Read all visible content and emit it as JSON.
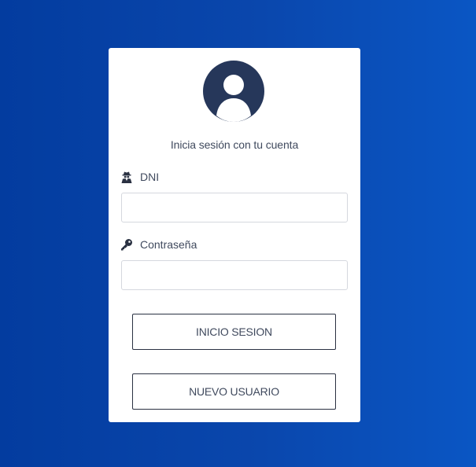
{
  "login": {
    "subtitle": "Inicia sesión con tu cuenta",
    "dni_label": "DNI",
    "dni_value": "",
    "password_label": "Contraseña",
    "password_value": "",
    "login_button": "INICIO SESION",
    "register_button": "NUEVO USUARIO"
  },
  "icons": {
    "avatar": "user-avatar-icon",
    "dni": "user-secret-icon",
    "password": "key-icon"
  },
  "colors": {
    "background_start": "#033c9f",
    "background_end": "#0a56c4",
    "card": "#ffffff",
    "avatar": "#26375a",
    "text": "#404a5e"
  }
}
